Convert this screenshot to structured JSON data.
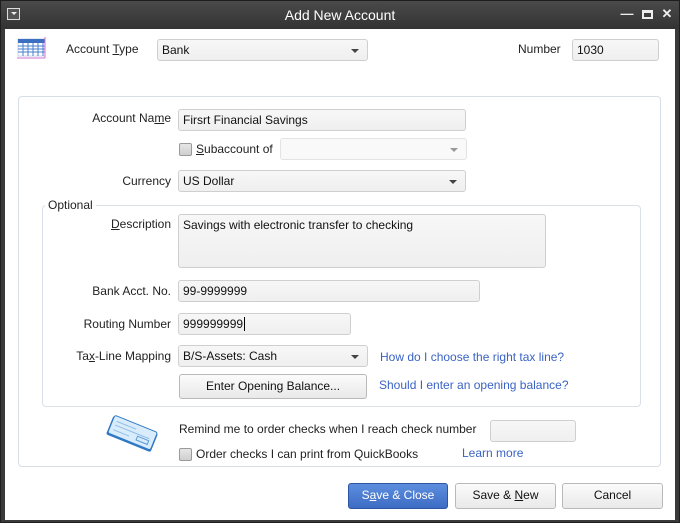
{
  "window": {
    "title": "Add New Account",
    "controls": {
      "minimize": "—",
      "close": "✕"
    }
  },
  "header": {
    "account_type_label_pre": "Account ",
    "account_type_label_key": "T",
    "account_type_label_post": "ype",
    "account_type_value": "Bank",
    "number_label": "Number",
    "number_value": "1030"
  },
  "main": {
    "account_name_label_pre": "Account Na",
    "account_name_label_key": "m",
    "account_name_label_post": "e",
    "account_name_value": "Firsrt Financial Savings",
    "subaccount_label_key": "S",
    "subaccount_label_post": "ubaccount of",
    "subaccount_checked": false,
    "subaccount_value": "",
    "currency_label": "Currency",
    "currency_value": "US Dollar"
  },
  "optional": {
    "legend": "Optional",
    "description_label_key": "D",
    "description_label_post": "escription",
    "description_value": "Savings with electronic transfer to checking",
    "bank_acct_label": "Bank Acct. No.",
    "bank_acct_value": "99-9999999",
    "routing_label": "Routing Number",
    "routing_value": "999999999",
    "taxline_label_pre": "Ta",
    "taxline_label_key": "x",
    "taxline_label_post": "-Line Mapping",
    "taxline_value": "B/S-Assets: Cash",
    "taxline_help_link": "How do I choose the right tax line?",
    "opening_balance_button_pre": "Enter Openin",
    "opening_balance_button_key": "g",
    "opening_balance_button_post": " Balance...",
    "opening_balance_help_link": "Should I enter an opening balance?"
  },
  "checks": {
    "remind_label": "Remind me to order checks when I reach check number",
    "remind_value": "",
    "order_checks_label": "Order checks I can print from QuickBooks",
    "order_checks_checked": false,
    "learn_more_link": "Learn more"
  },
  "footer": {
    "save_close_pre": "S",
    "save_close_key": "a",
    "save_close_post": "ve & Close",
    "save_new_pre": "Save & ",
    "save_new_key": "N",
    "save_new_post": "ew",
    "cancel": "Cancel"
  },
  "colors": {
    "primary_button": "#3d6cc4",
    "link": "#3a63c4",
    "titlebar": "#3a3a3a"
  }
}
